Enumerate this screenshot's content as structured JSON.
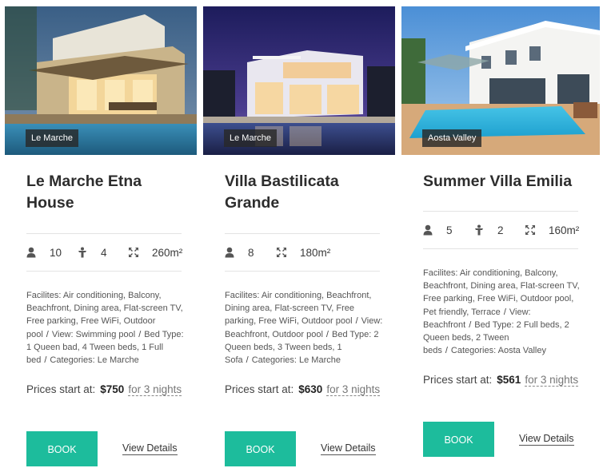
{
  "listings": [
    {
      "tag": "Le Marche",
      "title": "Le Marche Etna House",
      "specs": [
        {
          "icon": "guests-icon",
          "value": "10"
        },
        {
          "icon": "bedroom-icon",
          "value": "4"
        },
        {
          "icon": "area-icon",
          "value": "260m²"
        }
      ],
      "facilities": "Facilites: Air conditioning, Balcony, Beachfront, Dining area, Flat-screen TV, Free parking, Free WiFi, Outdoor pool",
      "view": "View: Swimming pool",
      "bed_type": "Bed Type: 1 Queen bad, 4 Tween beds, 1 Full bed",
      "categories": "Categories: Le Marche",
      "price_label": "Prices start at:",
      "price": "$750",
      "per": "for 3 nights",
      "book_label": "BOOK",
      "details_label": "View Details"
    },
    {
      "tag": "Le Marche",
      "title": "Villa Bastilicata Grande",
      "specs": [
        {
          "icon": "guests-icon",
          "value": "8"
        },
        {
          "icon": "area-icon",
          "value": "180m²"
        }
      ],
      "facilities": "Facilites: Air conditioning, Beachfront, Dining area, Flat-screen TV, Free parking, Free WiFi, Outdoor pool",
      "view": "View: Beachfront, Outdoor pool",
      "bed_type": "Bed Type: 2 Queen beds, 3 Tween beds, 1 Sofa",
      "categories": "Categories: Le Marche",
      "price_label": "Prices start at:",
      "price": "$630",
      "per": "for 3 nights",
      "book_label": "BOOK",
      "details_label": "View Details"
    },
    {
      "tag": "Aosta Valley",
      "title": "Summer Villa Emilia",
      "specs": [
        {
          "icon": "guests-icon",
          "value": "5"
        },
        {
          "icon": "bedroom-icon",
          "value": "2"
        },
        {
          "icon": "area-icon",
          "value": "160m²"
        }
      ],
      "facilities": "Facilites: Air conditioning, Balcony, Beachfront, Dining area, Flat-screen TV, Free parking, Free WiFi, Outdoor pool, Pet friendly, Terrace",
      "view": "View: Beachfront",
      "bed_type": "Bed Type: 2 Full beds, 2 Queen beds, 2 Tween beds",
      "categories": "Categories: Aosta Valley",
      "price_label": "Prices start at:",
      "price": "$561",
      "per": "for 3 nights",
      "book_label": "BOOK",
      "details_label": "View Details"
    }
  ],
  "colors": {
    "accent": "#1dbc9c",
    "tag_bg": "#2a2a2a",
    "divider": "#e3e3e3"
  }
}
